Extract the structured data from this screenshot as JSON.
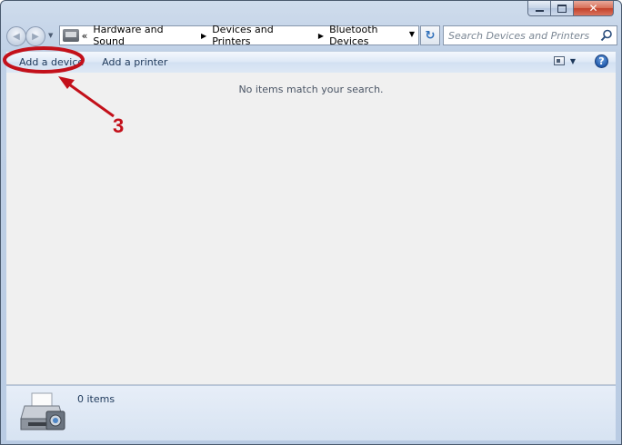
{
  "window": {
    "caption": {
      "minimize": "–",
      "maximize": "▢",
      "close": "✕"
    }
  },
  "nav": {
    "breadcrumb_overflow": "«",
    "breadcrumb": [
      "Hardware and Sound",
      "Devices and Printers",
      "Bluetooth Devices"
    ],
    "search_placeholder": "Search Devices and Printers"
  },
  "toolbar": {
    "add_device": "Add a device",
    "add_printer": "Add a printer",
    "help": "?"
  },
  "content": {
    "empty_message": "No items match your search."
  },
  "details": {
    "item_count": "0 items"
  },
  "annotation": {
    "step_number": "3",
    "color": "#c3101a"
  },
  "icons": {
    "back": "arrow-left-icon",
    "forward": "arrow-right-icon",
    "refresh": "refresh-icon",
    "search": "search-icon",
    "view": "view-icon",
    "help": "help-icon",
    "printer": "printer-icon"
  }
}
